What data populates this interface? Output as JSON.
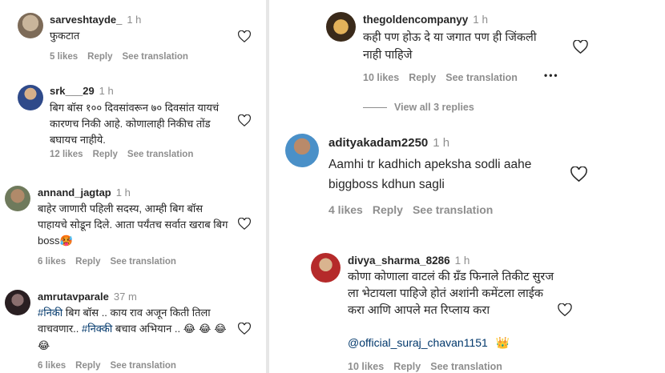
{
  "left_comments": [
    {
      "username": "sarveshtayde_",
      "time": "1 h",
      "text": "फुकटात",
      "likes": "5 likes",
      "reply": "Reply",
      "translate": "See translation"
    },
    {
      "username": "srk___29",
      "time": "1 h",
      "text": "बिग बॉस १०० दिवसांवरून ७० दिवसांत यायचं कारणच निकी आहे. कोणालाही निकीच तोंड बघायच नाहीये.",
      "likes": "12 likes",
      "reply": "Reply",
      "translate": "See translation"
    },
    {
      "username": "annand_jagtap",
      "time": "1 h",
      "text": "बाहेर जाणारी पहिली सदस्य, आम्ही बिग बॉस पाहायचे सोडून दिले. आता पर्यंतच सर्वात खराब बिग boss",
      "emoji": "🥵",
      "likes": "6 likes",
      "reply": "Reply",
      "translate": "See translation"
    },
    {
      "username": "amrutavparale",
      "time": "37 m",
      "hashtag1": "#निकी",
      "text1": " बिग बॉस .. काय राव अजून किती तिला वाचवणार.. ",
      "hashtag2": "#निक्की",
      "text2": " बचाव अभियान ..",
      "emojis": "😂 😂 😂 😂",
      "likes": "6 likes",
      "reply": "Reply",
      "translate": "See translation"
    }
  ],
  "right_comments": [
    {
      "username": "thegoldencompanyy",
      "time": "1 h",
      "text": "कही पण होऊ दे या जगात पण ही जिंकली नाही पाहिजे",
      "likes": "10 likes",
      "reply": "Reply",
      "translate": "See translation",
      "more": "•••",
      "view_replies": "View all 3 replies"
    },
    {
      "username": "adityakadam2250",
      "time": "1 h",
      "text": "Aamhi tr kadhich apeksha sodli aahe biggboss kdhun sagli",
      "likes": "4 likes",
      "reply": "Reply",
      "translate": "See translation"
    },
    {
      "username": "divya_sharma_8286",
      "time": "1 h",
      "text": "कोणा कोणाला वाटलं की ग्रँड फिनाले तिकीट सुरज ला भेटायला पाहिजे होतं अशांनी कमेंटला लाईक करा आणि आपले मत रिप्लाय करा",
      "mention": "@official_suraj_chavan1151",
      "emoji": "👑",
      "likes": "10 likes",
      "reply": "Reply",
      "translate": "See translation"
    }
  ],
  "colors": {
    "primary_text": "#262626",
    "secondary_text": "#8e8e8e",
    "link": "#00376b",
    "separator": "#e6e6e6"
  }
}
